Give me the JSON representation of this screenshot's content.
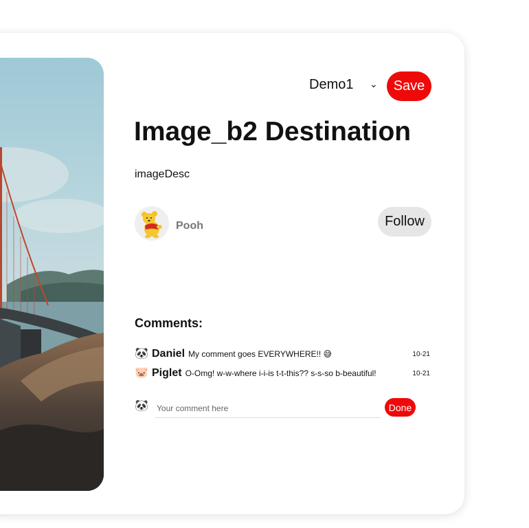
{
  "pin": {
    "image_subject": "golden-gate-bridge-photo",
    "board_select": {
      "selected": "Demo1"
    },
    "save_label": "Save",
    "title": "Image_b2 Destination",
    "description": "imageDesc"
  },
  "author": {
    "name": "Pooh",
    "avatar_icon": "pooh-bear-avatar",
    "follow_label": "Follow"
  },
  "comments": {
    "heading": "Comments:",
    "items": [
      {
        "icon": "panda-icon",
        "emoji": "🐼",
        "name": "Daniel",
        "text": "My comment goes EVERYWHERE!! 😅",
        "date": "10-21"
      },
      {
        "icon": "piglet-icon",
        "emoji": "🐷",
        "name": "Piglet",
        "text": "O-Omg! w-w-where i-i-is t-t-this?? s-s-so b-beautiful!",
        "date": "10-21"
      }
    ],
    "input": {
      "icon": "panda-icon",
      "emoji": "🐼",
      "placeholder": "Your comment here",
      "value": ""
    },
    "done_label": "Done"
  },
  "colors": {
    "accent_red": "#ef0a0a",
    "follow_bg": "#e6e6e6",
    "username_gray": "#767676"
  }
}
